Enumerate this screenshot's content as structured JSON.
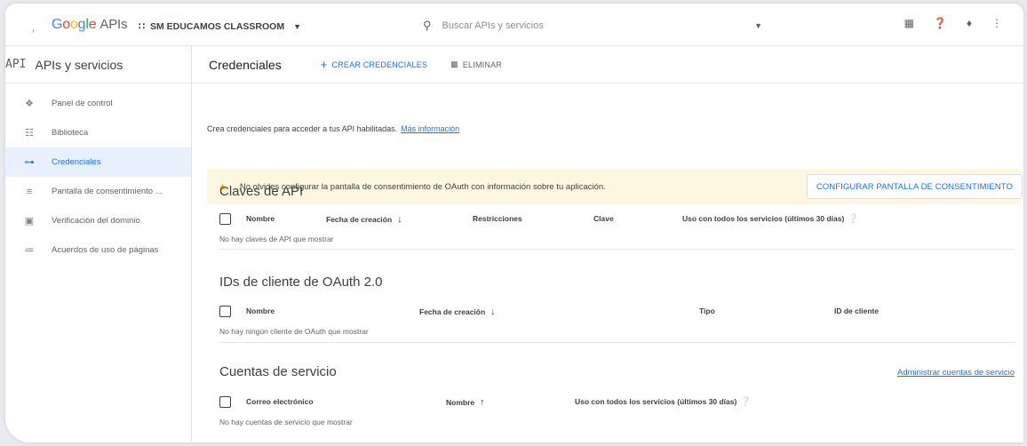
{
  "topbar": {
    "logo_google": "Google",
    "logo_apis": "APIs",
    "project": "SM EDUCAMOS CLASSROOM",
    "search_placeholder": "Buscar APIs y servicios"
  },
  "sidebar": {
    "api_label": "API",
    "title": "APIs y servicios",
    "items": [
      {
        "label": "Panel de control",
        "icon": "dashboard-icon"
      },
      {
        "label": "Biblioteca",
        "icon": "library-icon"
      },
      {
        "label": "Credenciales",
        "icon": "key-icon",
        "active": true
      },
      {
        "label": "Pantalla de consentimiento ...",
        "icon": "consent-icon"
      },
      {
        "label": "Verificación del dominio",
        "icon": "domain-icon"
      },
      {
        "label": "Acuerdos de uso de páginas",
        "icon": "settings-list-icon"
      }
    ]
  },
  "main": {
    "title": "Credenciales",
    "create_label": "CREAR CREDENCIALES",
    "delete_label": "ELIMINAR",
    "intro_text": "Crea credenciales para acceder a tus API habilitadas.",
    "intro_link": "Más información",
    "banner": {
      "message": "No olvides configurar la pantalla de consentimiento de OAuth con información sobre tu aplicación.",
      "button": "CONFIGURAR PANTALLA DE CONSENTIMIENTO"
    },
    "api_keys": {
      "title": "Claves de API",
      "columns": [
        "Nombre",
        "Fecha de creación",
        "Restricciones",
        "Clave",
        "Uso con todos los servicios (últimos 30 días)"
      ],
      "empty": "No hay claves de API que mostrar"
    },
    "oauth": {
      "title": "IDs de cliente de OAuth 2.0",
      "columns": [
        "Nombre",
        "Fecha de creación",
        "Tipo",
        "ID de cliente"
      ],
      "empty": "No hay ningún cliente de OAuth que mostrar"
    },
    "service_accounts": {
      "title": "Cuentas de servicio",
      "manage_link": "Administrar cuentas de servicio",
      "columns": [
        "Correo electrónico",
        "Nombre",
        "Uso con todos los servicios (últimos 30 días)"
      ],
      "empty": "No hay cuentas de servicio que mostrar"
    }
  },
  "colors": {
    "accent": "#1a73e8",
    "warning_bg": "#fef7e0",
    "warning_icon": "#f9ab00",
    "active_bg": "#e8f0fe"
  }
}
